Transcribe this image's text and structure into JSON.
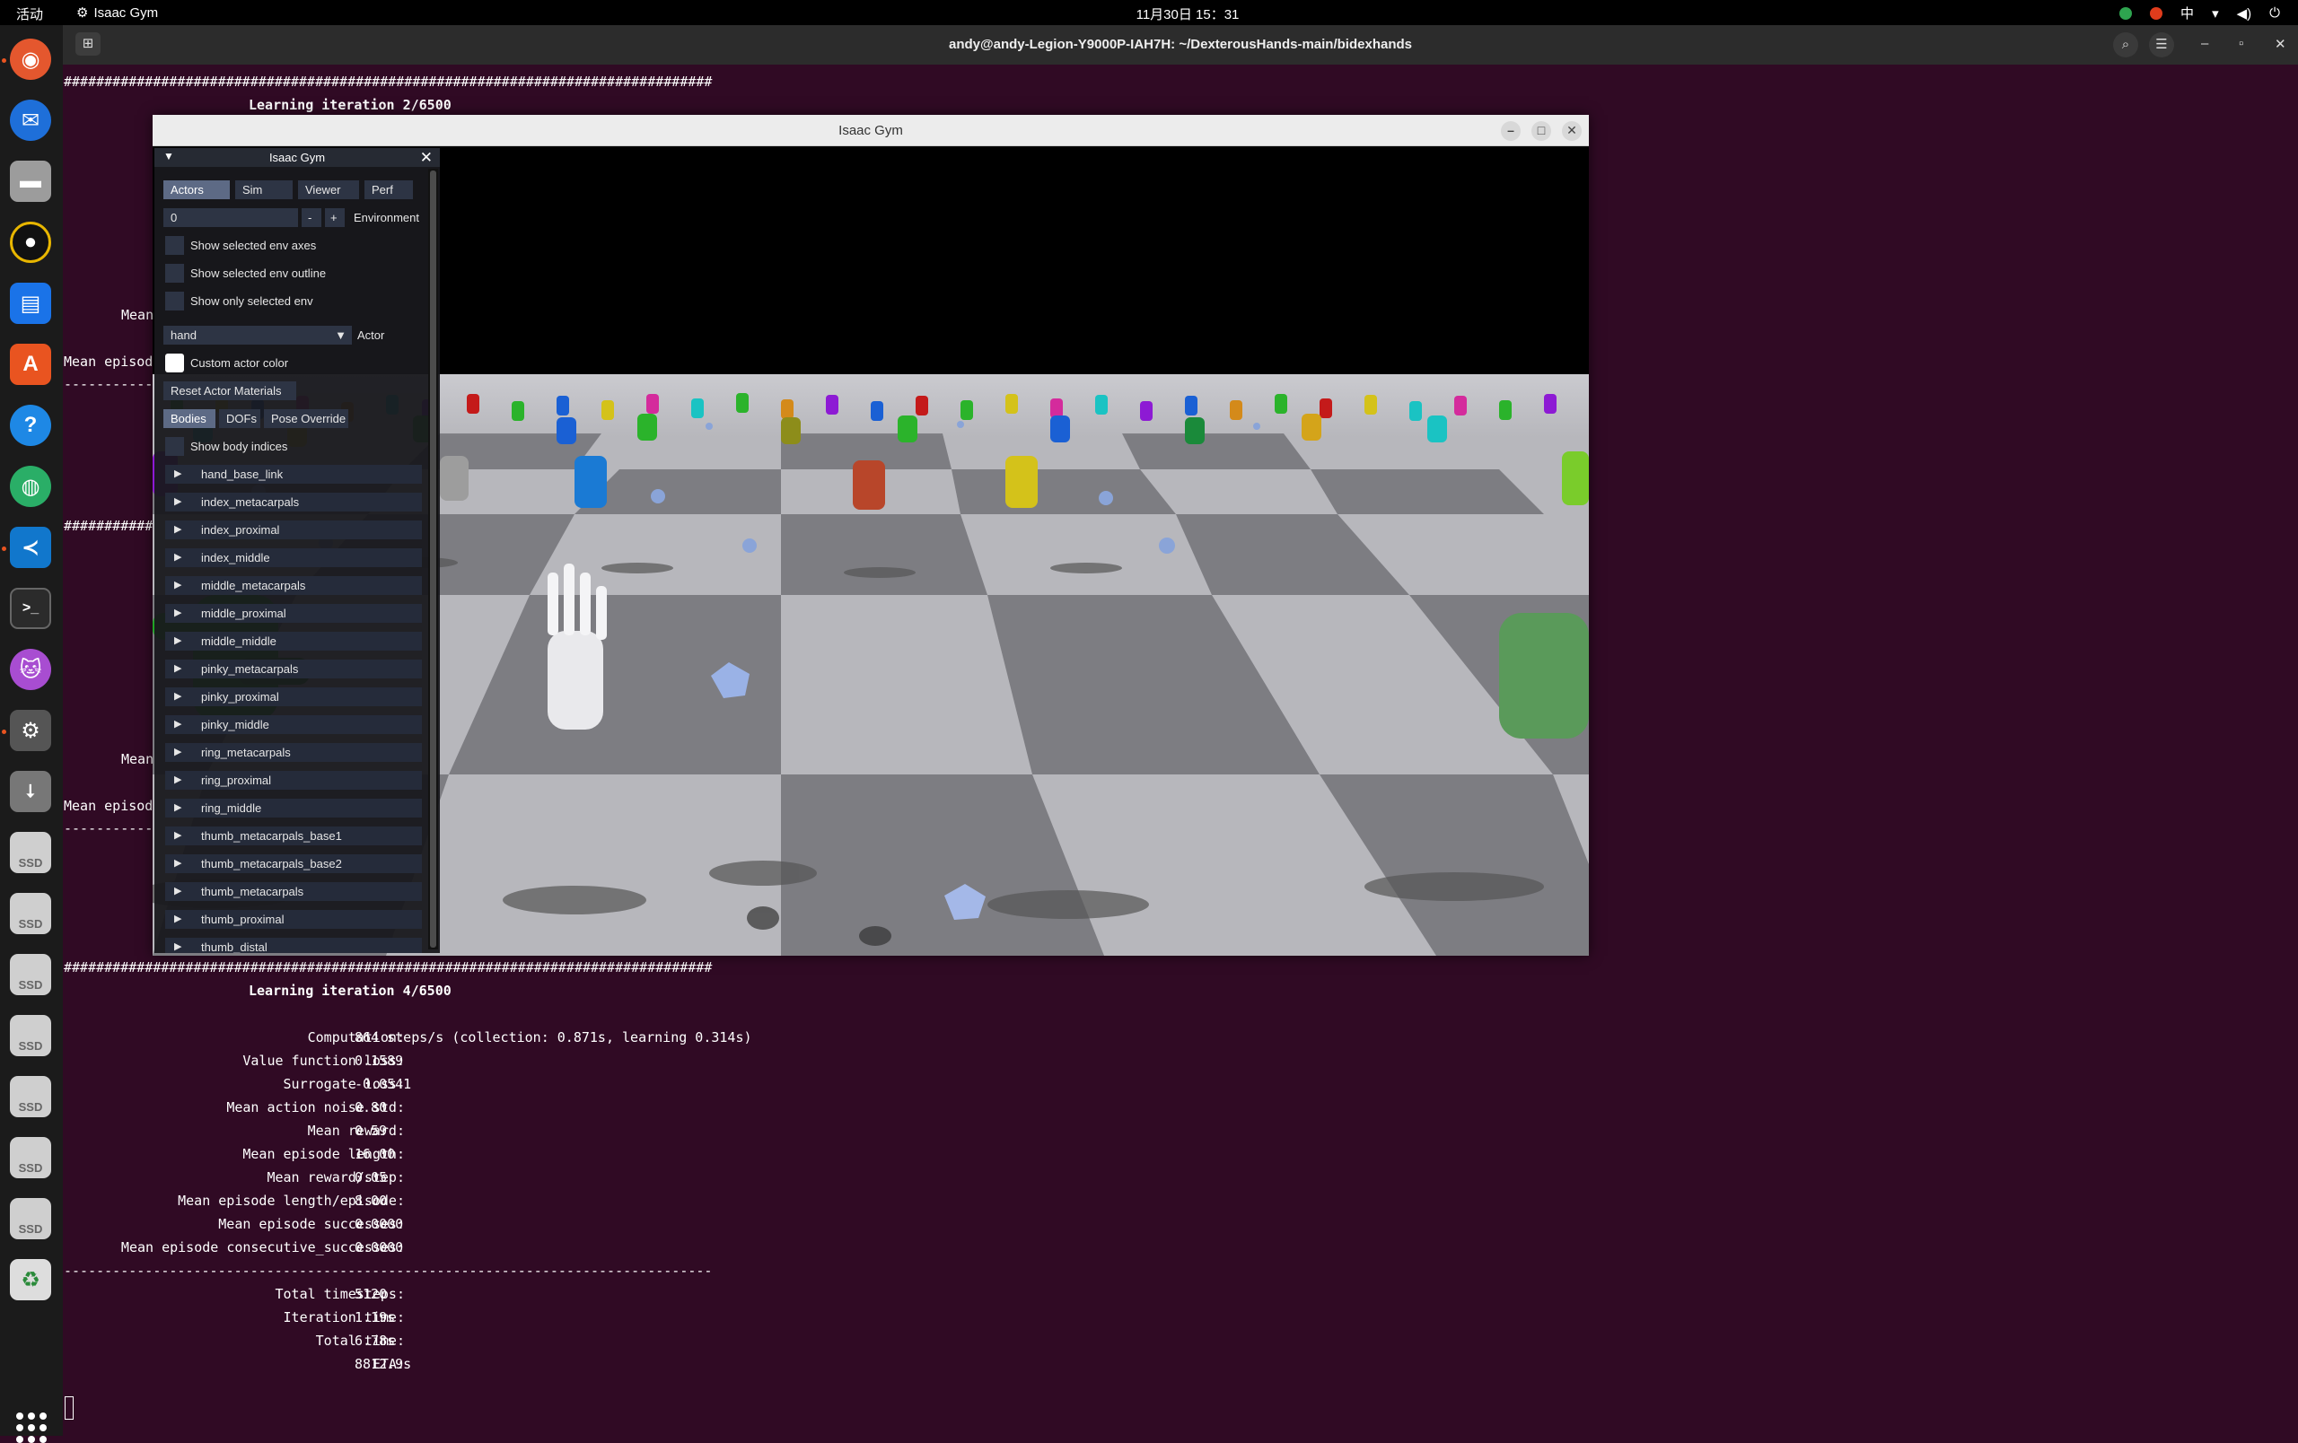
{
  "topbar": {
    "activities": "活动",
    "app_name": "Isaac Gym",
    "clock": "11月30日  15：31",
    "ime": "中"
  },
  "terminal": {
    "title": "andy@andy-Legion-Y9000P-IAH7H: ~/DexterousHands-main/bidexhands",
    "hashes": "################################################################################",
    "dashes": "--------------------------------------------------------------------------------",
    "iteration2": "Learning iteration 2/6500",
    "partial_lines": [
      "Mean",
      "Mean episod",
      "------------",
      "Mean",
      "Mean episod",
      "------------",
      "############"
    ],
    "iteration4": "Learning iteration 4/6500",
    "stats": [
      {
        "label": "Computation:",
        "value": "864 steps/s (collection: 0.871s, learning 0.314s)"
      },
      {
        "label": "Value function loss:",
        "value": "0.1589"
      },
      {
        "label": "Surrogate loss:",
        "value": "-0.0541"
      },
      {
        "label": "Mean action noise std:",
        "value": "0.80"
      },
      {
        "label": "Mean reward:",
        "value": "0.59"
      },
      {
        "label": "Mean episode length:",
        "value": "16.00"
      },
      {
        "label": "Mean reward/step:",
        "value": "0.05"
      },
      {
        "label": "Mean episode length/episode:",
        "value": "8.00"
      },
      {
        "label": "Mean episode successes:",
        "value": "0.0000"
      },
      {
        "label": "Mean episode consecutive_successes:",
        "value": "0.0000"
      }
    ],
    "stats2": [
      {
        "label": "Total timesteps:",
        "value": "5120"
      },
      {
        "label": "Iteration time:",
        "value": "1.19s"
      },
      {
        "label": "Total time:",
        "value": "6.78s"
      },
      {
        "label": "ETA:",
        "value": "8812.9s"
      }
    ]
  },
  "gym_window": {
    "title": "Isaac Gym"
  },
  "panel": {
    "title": "Isaac Gym",
    "tabs": [
      "Actors",
      "Sim",
      "Viewer",
      "Perf"
    ],
    "env_value": "0",
    "env_minus": "-",
    "env_plus": "+",
    "env_label": "Environment",
    "checkboxes": [
      "Show selected env axes",
      "Show selected env outline",
      "Show only selected env"
    ],
    "actor_value": "hand",
    "actor_label": "Actor",
    "custom_color": "Custom actor color",
    "reset_button": "Reset Actor Materials",
    "subtabs": [
      "Bodies",
      "DOFs",
      "Pose Override"
    ],
    "show_indices": "Show body indices",
    "bodies": [
      "hand_base_link",
      "index_metacarpals",
      "index_proximal",
      "index_middle",
      "middle_metacarpals",
      "middle_proximal",
      "middle_middle",
      "pinky_metacarpals",
      "pinky_proximal",
      "pinky_middle",
      "ring_metacarpals",
      "ring_proximal",
      "ring_middle",
      "thumb_metacarpals_base1",
      "thumb_metacarpals_base2",
      "thumb_metacarpals",
      "thumb_proximal",
      "thumb_distal"
    ]
  }
}
